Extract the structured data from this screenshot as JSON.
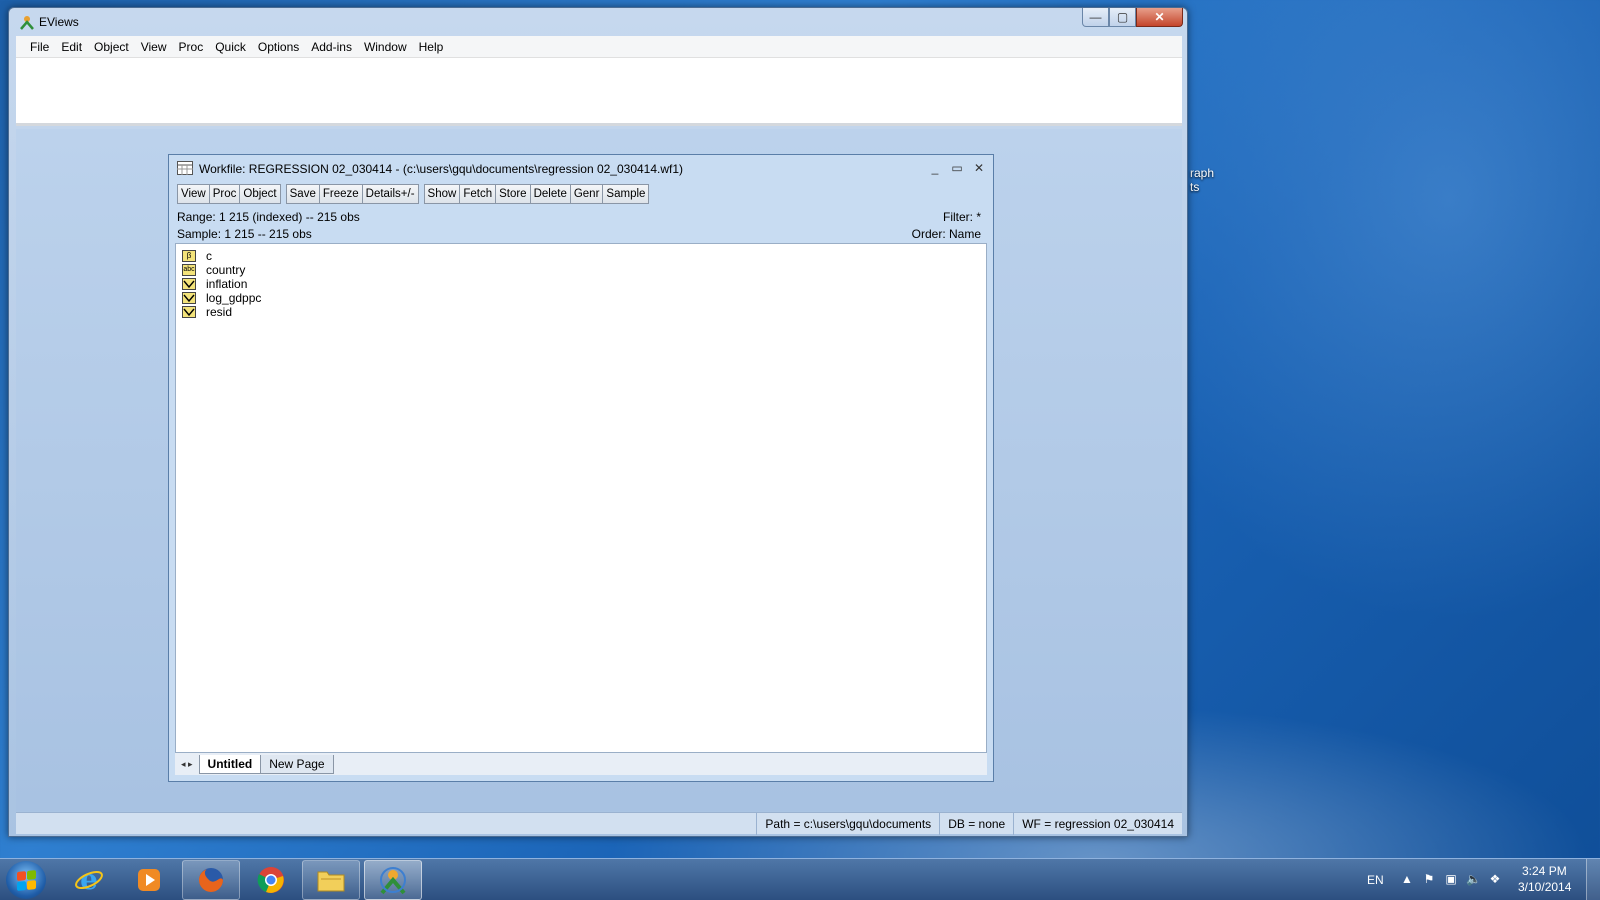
{
  "desktop": {
    "partial_icon_label": "raph\nts"
  },
  "main_window": {
    "title": "EViews",
    "menu": [
      "File",
      "Edit",
      "Object",
      "View",
      "Proc",
      "Quick",
      "Options",
      "Add-ins",
      "Window",
      "Help"
    ],
    "controls": {
      "minimize": "—",
      "maximize": "▢",
      "close": "✕"
    },
    "status": {
      "path": "Path = c:\\users\\gqu\\documents",
      "db": "DB = none",
      "wf": "WF = regression 02_030414"
    }
  },
  "workfile": {
    "title": "Workfile: REGRESSION 02_030414 - (c:\\users\\gqu\\documents\\regression 02_030414.wf1)",
    "toolbar_group1": [
      "View",
      "Proc",
      "Object"
    ],
    "toolbar_group2": [
      "Save",
      "Freeze",
      "Details+/-"
    ],
    "toolbar_group3": [
      "Show",
      "Fetch",
      "Store",
      "Delete",
      "Genr",
      "Sample"
    ],
    "range": "Range:  1 215 (indexed)  --  215 obs",
    "sample": "Sample: 1 215  --  215 obs",
    "filter": "Filter: *",
    "order": "Order: Name",
    "objects": [
      {
        "name": "c",
        "type": "coef",
        "icon_label": "β"
      },
      {
        "name": "country",
        "type": "alpha",
        "icon_label": "abc"
      },
      {
        "name": "inflation",
        "type": "series",
        "icon_label": ""
      },
      {
        "name": "log_gdppc",
        "type": "series",
        "icon_label": ""
      },
      {
        "name": "resid",
        "type": "series",
        "icon_label": ""
      }
    ],
    "tabs": [
      "Untitled",
      "New Page"
    ],
    "active_tab": "Untitled"
  },
  "taskbar": {
    "apps": [
      "start-orb",
      "internet-explorer",
      "media-player",
      "firefox",
      "chrome",
      "file-explorer",
      "eviews"
    ],
    "language": "EN",
    "time": "3:24 PM",
    "date": "3/10/2014"
  }
}
